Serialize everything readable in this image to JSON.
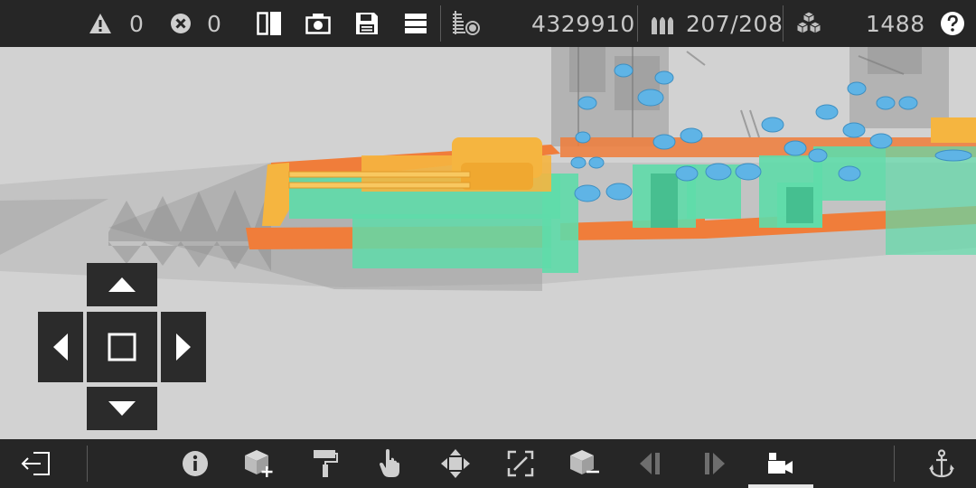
{
  "topbar": {
    "warning_count": "0",
    "error_count": "0",
    "points": "4329910",
    "ammo": "207/208",
    "blocks": "1488"
  },
  "icons": {
    "warning": "warning-icon",
    "error": "error-icon",
    "mirror": "mirror-icon",
    "screenshot": "camera-icon",
    "save": "save-icon",
    "layers": "layers-icon",
    "stats": "ship-stats-icon",
    "ammo": "ammo-icon",
    "blocks": "blocks-icon",
    "help": "help-icon"
  },
  "bottombar": {
    "tools": [
      "exit",
      "info",
      "add-block",
      "paint",
      "select",
      "move",
      "rotate",
      "remove-block",
      "step-back",
      "step-forward",
      "camera-mode",
      "anchor"
    ],
    "active_tool": "camera-mode"
  },
  "colors": {
    "bar_bg": "#262626",
    "viewport_bg": "#d2d2d2",
    "armor_orange": "#f07d3a",
    "armor_green": "#5fdcaa",
    "turret_yellow": "#f5b540",
    "gun_blue": "#5fb4e6"
  }
}
